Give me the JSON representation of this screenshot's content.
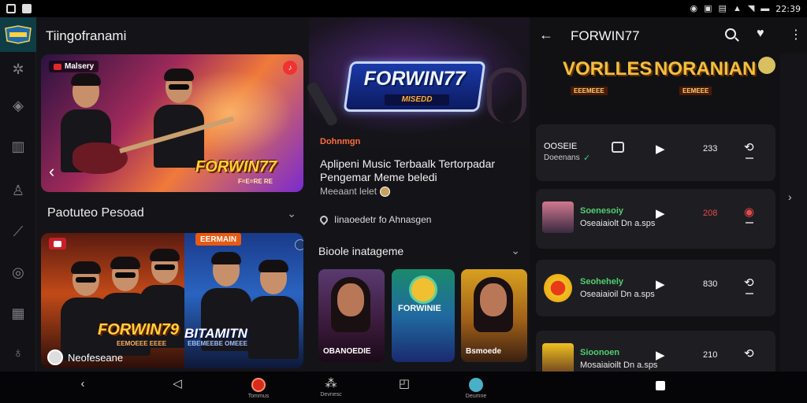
{
  "status_bar": {
    "time": "22:39",
    "icons": [
      "notification-icon",
      "alarm-icon",
      "nfc-icon",
      "signal-icon",
      "wifi-icon",
      "battery-icon"
    ]
  },
  "rail": {
    "icons": [
      "star-icon",
      "layers-icon",
      "chart-icon",
      "person-icon",
      "guitar-icon",
      "vinyl-icon",
      "library-icon",
      "profile-icon"
    ]
  },
  "panel1": {
    "title": "Tiingofranami",
    "hero": {
      "badge": "Malsery",
      "brand": "FORWIN77",
      "brand_sub": "F=E=RE RE"
    },
    "section_title": "Paotuteo Pesoad",
    "feature": {
      "badge_left": "",
      "badge_right": "EERMAIN",
      "brand_left": "FORWIN79",
      "brand_left_sub": "EEMOEEE EEEE",
      "brand_right": "BITAMITN",
      "brand_right_sub": "EBEMEEBE OMEEE",
      "footer_text": "Neofeseane"
    }
  },
  "panel2": {
    "logo_text": "FORWIN77",
    "logo_sub": "MISEDD",
    "label": "Dohnmgn",
    "desc_line1": "Aplipeni Music Terbaalk  Tertorpadar",
    "desc_line2": "Pengemar Meme beledi",
    "meta": "Meeaant lelet",
    "location": "Iinaoedetr fo Ahnasgen",
    "section_title": "Bioole inatageme",
    "thumbs": [
      {
        "label": "OBANOEDIE"
      },
      {
        "label": "FORWINIE"
      },
      {
        "label": "Bsmoede"
      }
    ]
  },
  "panel3": {
    "title": "FORWIN77",
    "brand1": "VORLLES",
    "brand1_sub": "EEEMEEE",
    "brand2": "NORANIAN",
    "brand2_sub": "EEMEEE",
    "rows": [
      {
        "title": "OOSEIE",
        "subtitle": "Doeenans",
        "count": "233"
      },
      {
        "title": "Soenesoiy",
        "subtitle": "Oseaiaiolt Dn a.sps",
        "count": "208"
      },
      {
        "title": "Seohehely",
        "subtitle": "Oseaiaioil Dn a.sps",
        "count": "830"
      },
      {
        "title": "Sioonoen",
        "subtitle": "Mosaiaioilt Dn a.sps",
        "count": "210"
      }
    ]
  },
  "navbar": {
    "items": [
      {
        "label": ""
      },
      {
        "label": ""
      },
      {
        "label": "Tommus"
      },
      {
        "label": "Devnesc"
      },
      {
        "label": ""
      },
      {
        "label": "Deumne"
      },
      {
        "label": ""
      }
    ]
  },
  "colors": {
    "accent_green": "#50d070",
    "accent_red": "#e84a4a",
    "brand_gold": "#ffd23a",
    "label_orange": "#ff6b3a"
  }
}
